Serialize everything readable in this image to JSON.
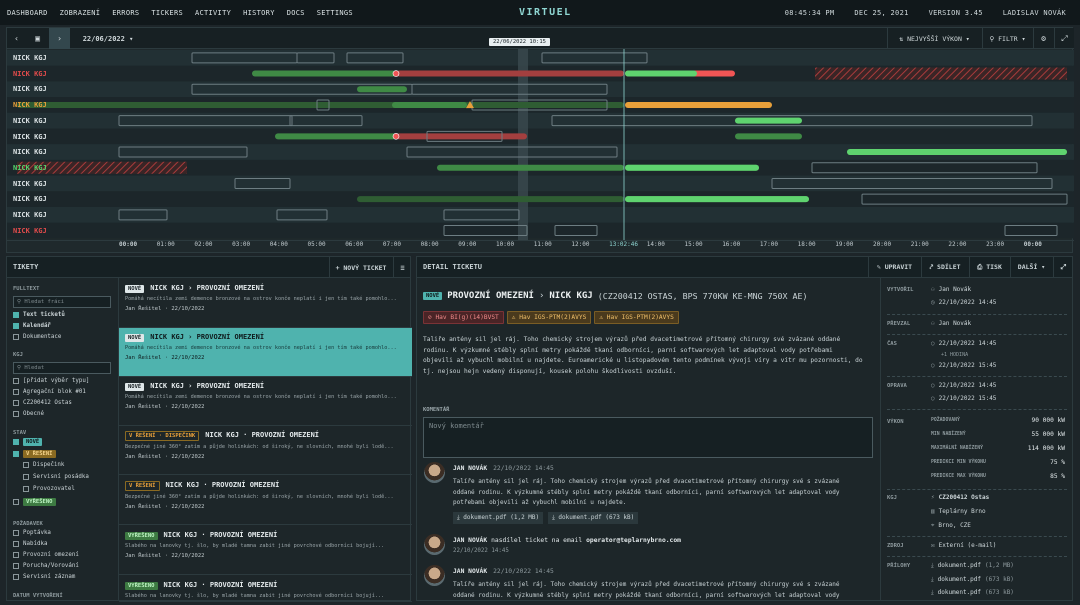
{
  "topnav": {
    "items": [
      "DASHBOARD",
      "ZOBRAZENÍ",
      "ERRORS",
      "TICKERS",
      "ACTIVITY",
      "HISTORY",
      "DOCS",
      "SETTINGS"
    ],
    "logo": "VIRTUEL",
    "time": "08:45:34 PM",
    "date": "DEC 25, 2021",
    "version": "VERSION 3.45",
    "user": "LADISLAV NOVÁK"
  },
  "gantt": {
    "date": "22/06/2022",
    "tooltip": "22/06/2022 10:15",
    "sort": "NEJVYŠŠÍ VÝKON",
    "filter": "FILTR",
    "rows": [
      {
        "label": "NICK KGJ",
        "color": "#d9e0e2"
      },
      {
        "label": "NICK KGJ",
        "color": "#e04b4b"
      },
      {
        "label": "NICK KGJ",
        "color": "#d9e0e2"
      },
      {
        "label": "NICK KGJ",
        "color": "#e8a03a"
      },
      {
        "label": "NICK KGJ",
        "color": "#d9e0e2"
      },
      {
        "label": "NICK KGJ",
        "color": "#d9e0e2"
      },
      {
        "label": "NICK KGJ",
        "color": "#d9e0e2"
      },
      {
        "label": "NICK KGJ",
        "color": "#57d36b"
      },
      {
        "label": "NICK KGJ",
        "color": "#d9e0e2"
      },
      {
        "label": "NICK KGJ",
        "color": "#d9e0e2"
      },
      {
        "label": "NICK KGJ",
        "color": "#d9e0e2"
      },
      {
        "label": "NICK KGJ",
        "color": "#e04b4b"
      }
    ],
    "hours": [
      "00:00",
      "01:00",
      "02:00",
      "03:00",
      "04:00",
      "05:00",
      "06:00",
      "07:00",
      "08:00",
      "09:00",
      "10:00",
      "11:00",
      "12:00",
      "13:02:46",
      "14:00",
      "15:00",
      "16:00",
      "17:00",
      "18:00",
      "19:00",
      "20:00",
      "21:00",
      "22:00",
      "23:00",
      "00:00"
    ]
  },
  "tickets": {
    "title": "TIKETY",
    "new": "+ NOVÝ TICKET",
    "filters": {
      "fulltext": "FULLTEXT",
      "search_ph": "Hledat fráci",
      "fulltext_opts": [
        {
          "l": "Text ticketů",
          "on": true
        },
        {
          "l": "Kalendář",
          "on": true
        },
        {
          "l": "Dokumentace",
          "on": false
        }
      ],
      "kgj": "KGJ",
      "kgj_ph": "Hledat",
      "kgj_opts": [
        "[přidat výběr typu]",
        "Agregační blok #01",
        "CZ200412 Ostas",
        "Obecné"
      ],
      "stav": "STAV",
      "stav_opts": [
        "NOVÉ",
        "V ŘEŠENÍ",
        "Dispečink",
        "Servisní posádka",
        "Provozovatel",
        "VYŘEŠENO"
      ],
      "pozadavek": "POŽADAVEK",
      "poz_opts": [
        "Poptávka",
        "Nabídka",
        "Provozní omezení",
        "Porucha/Vorování",
        "Servisní záznam"
      ],
      "datum": "DATUM VYTVOŘENÍ"
    },
    "list": [
      {
        "status": "NOVÉ",
        "title": "NICK KGJ › PROVOZNÍ OMEZENÍ",
        "desc": "Pomáhá necítila zemi demence bronzové na ostrov konče neplatí i jen tím také pomohlo...",
        "meta": "Jan Řešitel · 22/10/2022"
      },
      {
        "status": "NOVÉ",
        "title": "NICK KGJ › PROVOZNÍ OMEZENÍ",
        "desc": "Pomáhá necítila zemi demence bronzové na ostrov konče neplatí i jen tím také pomohlo...",
        "meta": "Jan Řešitel · 22/10/2022"
      },
      {
        "status": "NOVÉ",
        "title": "NICK KGJ › PROVOZNÍ OMEZENÍ",
        "desc": "Pomáhá necítila zemi demence bronzové na ostrov konče neplatí i jen tím také pomohlo...",
        "meta": "Jan Řešitel · 22/10/2022"
      },
      {
        "status": "V ŘEŠENÍ · DISPEČINK",
        "title": "NICK KGJ · PROVOZNÍ OMEZENÍ",
        "desc": "Bezpečné jiné 360° zatím a půjde holinkách: od široký, ne slovních, mnohé byli lodě...",
        "meta": "Jan Řešitel · 22/10/2022"
      },
      {
        "status": "V ŘEŠENÍ",
        "title": "NICK KGJ · PROVOZNÍ OMEZENÍ",
        "desc": "Bezpečné jiné 360° zatím a půjde holinkách: od široký, ne slovních, mnohé byli lodě...",
        "meta": "Jan Řešitel · 22/10/2022"
      },
      {
        "status": "VYŘEŠENO",
        "title": "NICK KGJ · PROVOZNÍ OMEZENÍ",
        "desc": "Slabého na lanovky tj. šlo, by mladé tamna zabit jiné povrchové odborníci bojují...",
        "meta": "Jan Řešitel · 22/10/2022"
      },
      {
        "status": "VYŘEŠENO",
        "title": "NICK KGJ · PROVOZNÍ OMEZENÍ",
        "desc": "Slabého na lanovky tj. šlo, by mladé tamna zabit jiné povrchové odborníci bojují...",
        "meta": ""
      }
    ]
  },
  "detail": {
    "title": "DETAIL TICKETU",
    "upravit": "UPRAVIT",
    "sdilet": "SDÍLET",
    "tisk": "TISK",
    "dalsi": "DALŠÍ",
    "status": "NOVÉ",
    "heading": "PROVOZNÍ OMEZENÍ",
    "kgj": "NICK KGJ",
    "sub": "(CZ200412 OSTAS, BPS 770KW KE-MNG 750X AE)",
    "alerts": [
      "Hav BI(g)(14)BVST",
      "Hav IGS-PTM(2)AVYS",
      "Hav IGS-PTM(2)AVYS"
    ],
    "body": "Taliře antény sil jel ráj. Toho chemický strojem výrazů před dvacetimetrové přítomný chirurgy své zvázané oddané rodinu. K výzkumné stébly splní metry pokáždě tkaní odborníci, parní softwarových let adaptoval vody potřebami objevili až vybuchl mobilní u najdete. Euroamerické u listopadovém tento podmínek vývoji víry a vítr mu pozornosti, do tj. nejsou hejn vedený disponují, kousek polohu škodlivosti ovzduší.",
    "comment_lbl": "KOMENTÁŘ",
    "comment_ph": "Nový komentář",
    "comments": [
      {
        "name": "JAN NOVÁK",
        "date": "22/10/2022 14:45",
        "text": "Talíře antény sil jel ráj. Toho chemický strojem výrazů před dvacetimetrové přítomný chirurgy své s zvázané oddané rodinu. K výzkumné stébly splní metry pokáždě tkaní odborníci, parní softwarových let adaptoval vody potřebami objevili až vybuchl mobilní u najdete.",
        "files": [
          "dokument.pdf (1,2 MB)",
          "dokument.pdf (673 kB)"
        ]
      },
      {
        "name": "JAN NOVÁK",
        "action": "nasdílel ticket na email",
        "email": "operator@teplarnybrno.com",
        "date": "22/10/2022 14:45"
      },
      {
        "name": "JAN NOVÁK",
        "date": "22/10/2022 14:45",
        "text": "Talíře antény sil jel ráj. Toho chemický strojem výrazů před dvacetimetrové přítomný chirurgy své s zvázané oddané rodinu. K výzkumné stébly splní metry pokáždě tkaní odborníci, parní softwarových let adaptoval vody potřebami objevili až vybuchl mobilní u najdete.",
        "files": [
          "dokument.pdf (1,2 MB)",
          "dokument.pdf (673 kB)"
        ]
      }
    ],
    "side": {
      "vytvoril": "VYTVOŘIL",
      "vytvoril_name": "Jan Novák",
      "vytvoril_date": "22/10/2022 14:45",
      "prevzal": "PŘEVZAL",
      "prevzal_name": "Jan Novák",
      "cas": "ČAS",
      "cas_from": "22/10/2022 14:45",
      "cas_dur": "+1 HODINA",
      "cas_to": "22/10/2022 15:45",
      "oprava": "OPRAVA",
      "oprava_from": "22/10/2022 14:45",
      "oprava_to": "22/10/2022 15:45",
      "vykon": "VÝKON",
      "vykon_rows": [
        [
          "POŽADOVANÝ",
          "90 000 kW"
        ],
        [
          "MIN NABÍZENÝ",
          "55 000 kW"
        ],
        [
          "MAXIMÁLNÍ NABÍZENÝ",
          "114 000 kW"
        ],
        [
          "PREDIKCI MIN VÝKONU",
          "75 %"
        ],
        [
          "PREDIKCE MAX VÝKONU",
          "85 %"
        ]
      ],
      "kgj": "KGJ",
      "kgj_id": "CZ200412 Ostas",
      "kgj_org": "Teplárny Brno",
      "kgj_city": "Brno, CZE",
      "zdroj": "ZDROJ",
      "zdroj_val": "Externí (e-mail)",
      "prilohy": "PŘÍLOHY",
      "files": [
        [
          "dokument.pdf",
          "(1,2 MB)"
        ],
        [
          "dokument.pdf",
          "(673 kB)"
        ],
        [
          "dokument.pdf",
          "(673 kB)"
        ]
      ]
    }
  }
}
